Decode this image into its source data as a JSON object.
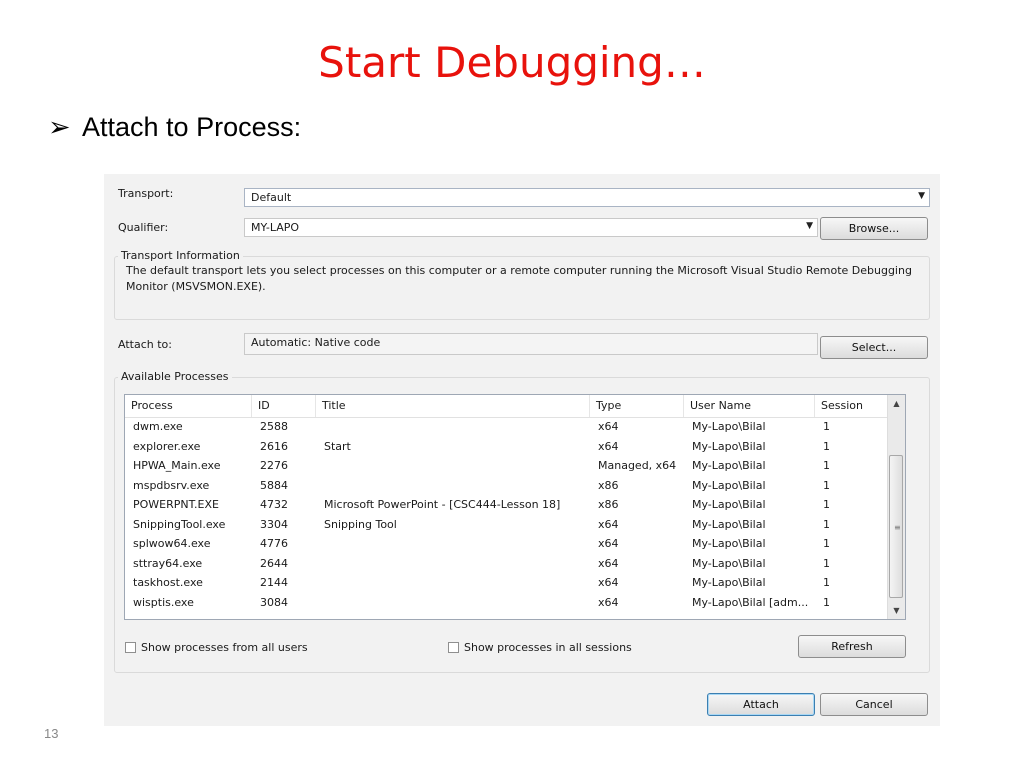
{
  "slide": {
    "title": "Start Debugging…",
    "bullet_arrow": "➢",
    "bullet_text": "Attach to Process:",
    "page_number": "13"
  },
  "dialog": {
    "transport_label": "Transport:",
    "transport_value": "Default",
    "qualifier_label": "Qualifier:",
    "qualifier_value": "MY-LAPO",
    "browse_button": "Browse...",
    "transport_info_title": "Transport Information",
    "transport_info_text_line1": "The default transport lets you select processes on this computer or a remote computer running the Microsoft Visual Studio Remote Debugging",
    "transport_info_text_line2": "Monitor (MSVSMON.EXE).",
    "attach_to_label": "Attach to:",
    "attach_to_value": "Automatic: Native code",
    "select_button": "Select...",
    "available_title": "Available Processes",
    "columns": [
      "Process",
      "ID",
      "Title",
      "Type",
      "User Name",
      "Session"
    ],
    "processes": [
      {
        "process": "dwm.exe",
        "id": "2588",
        "title": "",
        "type": "x64",
        "user": "My-Lapo\\Bilal",
        "session": "1"
      },
      {
        "process": "explorer.exe",
        "id": "2616",
        "title": "Start",
        "type": "x64",
        "user": "My-Lapo\\Bilal",
        "session": "1"
      },
      {
        "process": "HPWA_Main.exe",
        "id": "2276",
        "title": "",
        "type": "Managed, x64",
        "user": "My-Lapo\\Bilal",
        "session": "1"
      },
      {
        "process": "mspdbsrv.exe",
        "id": "5884",
        "title": "",
        "type": "x86",
        "user": "My-Lapo\\Bilal",
        "session": "1"
      },
      {
        "process": "POWERPNT.EXE",
        "id": "4732",
        "title": "Microsoft PowerPoint - [CSC444-Lesson 18]",
        "type": "x86",
        "user": "My-Lapo\\Bilal",
        "session": "1"
      },
      {
        "process": "SnippingTool.exe",
        "id": "3304",
        "title": "Snipping Tool",
        "type": "x64",
        "user": "My-Lapo\\Bilal",
        "session": "1"
      },
      {
        "process": "splwow64.exe",
        "id": "4776",
        "title": "",
        "type": "x64",
        "user": "My-Lapo\\Bilal",
        "session": "1"
      },
      {
        "process": "sttray64.exe",
        "id": "2644",
        "title": "",
        "type": "x64",
        "user": "My-Lapo\\Bilal",
        "session": "1"
      },
      {
        "process": "taskhost.exe",
        "id": "2144",
        "title": "",
        "type": "x64",
        "user": "My-Lapo\\Bilal",
        "session": "1"
      },
      {
        "process": "wisptis.exe",
        "id": "3084",
        "title": "",
        "type": "x64",
        "user": "My-Lapo\\Bilal [adm...",
        "session": "1"
      }
    ],
    "show_all_users_label": "Show processes from all users",
    "show_all_users_checked": false,
    "show_all_sessions_label": "Show processes in all sessions",
    "show_all_sessions_checked": false,
    "refresh_button": "Refresh",
    "attach_button": "Attach",
    "cancel_button": "Cancel"
  },
  "icons": {
    "dropdown": "chevron-down-icon",
    "scroll_up": "scroll-up-arrow-icon",
    "scroll_down": "scroll-down-arrow-icon"
  },
  "colors": {
    "title": "#e8120c",
    "dialog_bg": "#f2f2f2",
    "default_button_border": "#3c7fb1"
  }
}
